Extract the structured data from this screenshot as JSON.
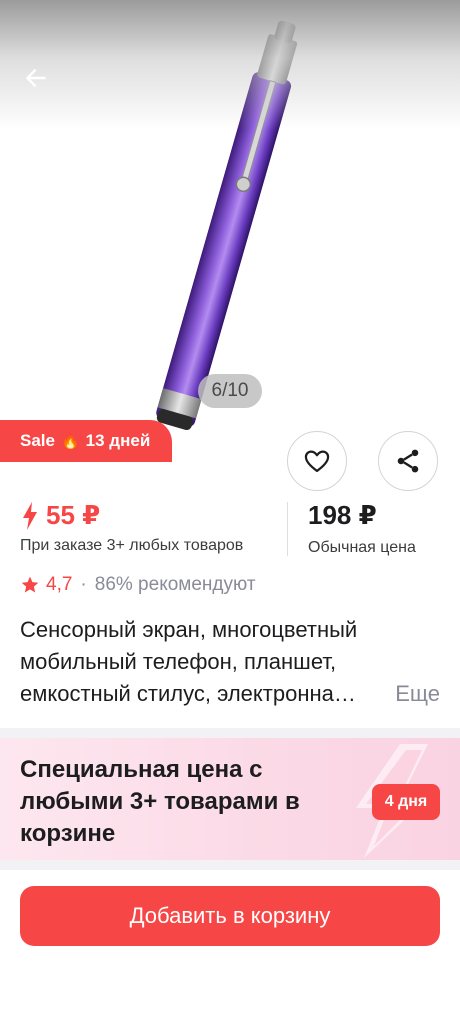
{
  "gallery": {
    "image_alt": "purple stylus pen",
    "counter": "6/10"
  },
  "badge": {
    "label": "Sale",
    "icon": "flame-icon",
    "days": "13 дней"
  },
  "actions": {
    "favorite_icon": "heart-icon",
    "share_icon": "share-icon"
  },
  "price": {
    "value": "55 ₽",
    "note": "При заказе 3+ любых товаров",
    "regular_value": "198 ₽",
    "regular_note": "Обычная цена"
  },
  "rating": {
    "value": "4,7",
    "separator": "·",
    "recommend": "86% рекомендуют"
  },
  "product": {
    "title_line1": "Сенсорный экран, многоцветный",
    "title_line2": "мобильный телефон, планшет,",
    "title_line3": "емкостный стилус, электронна…",
    "more": "Еще"
  },
  "promo": {
    "text": "Специальная цена с любыми 3+ товарами в корзине",
    "days": "4 дня"
  },
  "cart_button": "Добавить в корзину",
  "colors": {
    "accent": "#f74646",
    "muted": "#8a8a99",
    "promo_bg": "#fbd9e6"
  }
}
